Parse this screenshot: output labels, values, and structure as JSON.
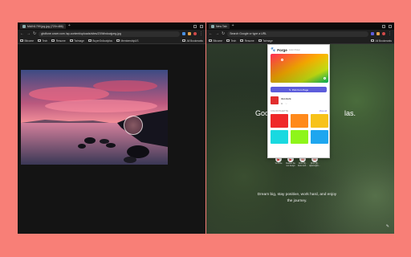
{
  "left_window": {
    "tab_title": "MAIN1799 jpg.jpg (720×486)",
    "url": "gbdfone.cover.com /ap-content/uploads/sites/ZXWindowjpeg.jpg",
    "bookmarks": [
      "Bitcome",
      "Tech",
      "Resume",
      "Twimage",
      "BuyerOrAnalytics",
      "MembershipUS"
    ],
    "bookmarks_right": "All Bookmarks"
  },
  "right_window": {
    "tab_title": "New Tab",
    "omnibox_placeholder": "Search Google or type a URL",
    "bookmarks": [
      "Bitcome",
      "Tech",
      "Resume",
      "Twimage"
    ],
    "bookmarks_right": "All Bookmarks",
    "heading_left": "Goo",
    "heading_right": "las.",
    "shortcuts": [
      {
        "label": "YouTube",
        "glyph": "▶",
        "color": "#e32424"
      },
      {
        "label": "Reaster the sun design",
        "glyph": "▶",
        "color": "#e32424"
      },
      {
        "label": "Inbox (6) - Refer and...",
        "glyph": "M",
        "color": "#d33b2d"
      },
      {
        "label": "Inbox (6) - dgherw@m...",
        "glyph": "M",
        "color": "#d33b2d"
      }
    ],
    "quote": "Dream big, stay positive, work hard, and enjoy the journey.",
    "customize_icon": "pencil-icon"
  },
  "popup": {
    "app_name": "Forge",
    "app_sub": "Color Picker",
    "pick_button": "Pick from Page",
    "current_hex": "#E12E2E",
    "palette_label": "COLOR PALETTE",
    "palette_link": "View all",
    "palette_colors": [
      "#ef2929",
      "#ff8a1c",
      "#f7c21a",
      "#19d9e0",
      "#8ef51a",
      "#1ea6ef"
    ]
  },
  "colors": {
    "background": "#f87f77",
    "accent": "#5d5ddb"
  }
}
